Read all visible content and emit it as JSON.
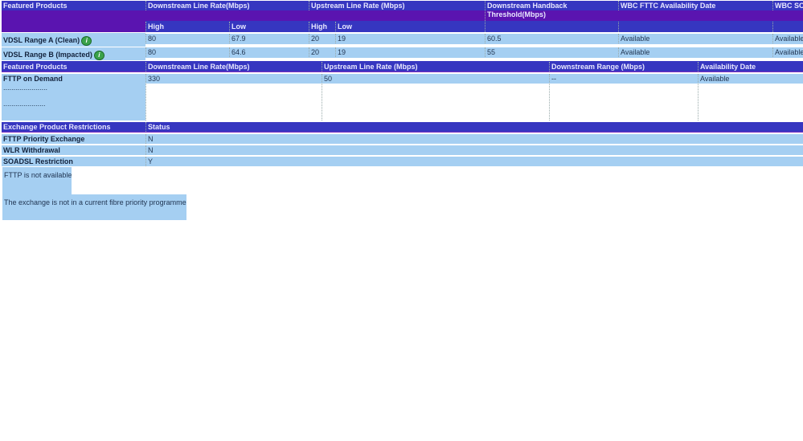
{
  "table1": {
    "headers": [
      "Featured Products",
      "Downstream Line Rate(Mbps)",
      "Upstream Line Rate (Mbps)",
      "Downstream Handback Threshold(Mbps)",
      "WBC FTTC Availability Date",
      "WBC SOG"
    ],
    "subheaders": [
      "High",
      "Low",
      "High",
      "Low"
    ],
    "rows": [
      {
        "name": "VDSL Range A (Clean)",
        "icon": "info-icon",
        "ds_high": "80",
        "ds_low": "67.9",
        "us_high": "20",
        "us_low": "19",
        "handback": "60.5",
        "fttc": "Available",
        "sogea": "Available"
      },
      {
        "name": "VDSL Range B (Impacted)",
        "icon": "info-icon",
        "ds_high": "80",
        "ds_low": "64.6",
        "us_high": "20",
        "us_low": "19",
        "handback": "55",
        "fttc": "Available",
        "sogea": "Available"
      }
    ]
  },
  "table2": {
    "headers": [
      "Featured Products",
      "Downstream Line Rate(Mbps)",
      "Upstream Line Rate (Mbps)",
      "Downstream Range (Mbps)",
      "Availability Date"
    ],
    "row": {
      "name": "FTTP on Demand",
      "ds": "330",
      "us": "50",
      "range": "--",
      "date": "Available",
      "dots1": "......................",
      "dots2": "....................."
    }
  },
  "table3": {
    "headers": [
      "Exchange Product Restrictions",
      "Status"
    ],
    "rows": [
      {
        "name": "FTTP Priority Exchange",
        "status": "N"
      },
      {
        "name": "WLR Withdrawal",
        "status": "N"
      },
      {
        "name": "SOADSL Restriction",
        "status": "Y"
      }
    ]
  },
  "notes": [
    "FTTP is not available.",
    "The exchange is not in a current fibre priority programme"
  ]
}
